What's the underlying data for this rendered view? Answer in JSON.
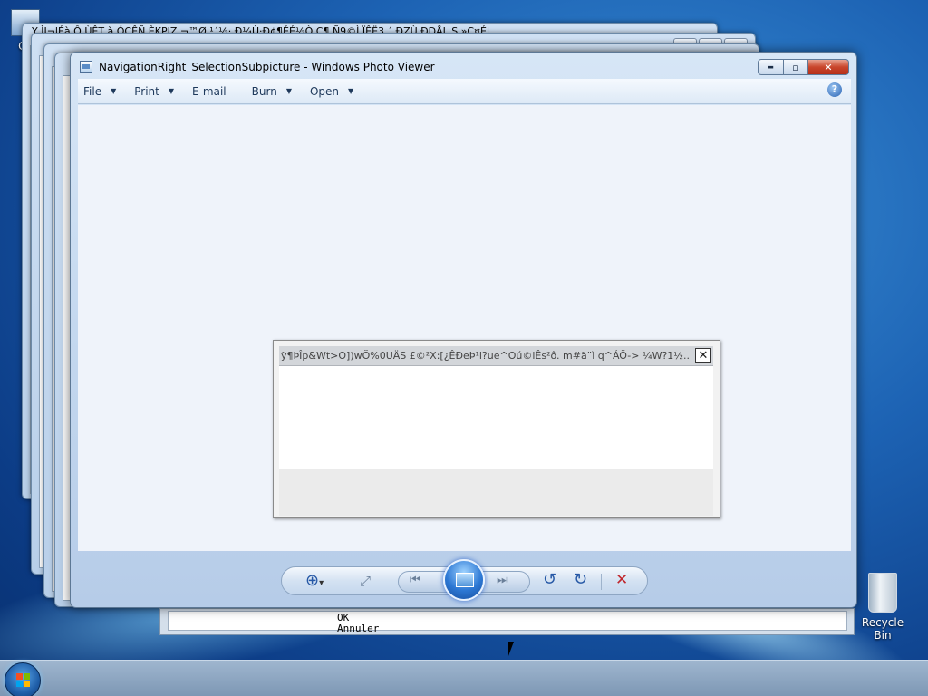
{
  "desktop": {
    "computer_label": "Co",
    "recycle_bin_label": "Recycle Bin"
  },
  "background_window": {
    "title_garbled": "Y  ÌI¬lÉà  Ô  ÙÊT   à  ÓÇÊÑ         ÈKPIZ  ¬™Ø  ¹´½·  Ð¼Ù·Ð¢¶ÉÉ½Ò  Ç¶ Ñ9©Ì    ÏÊË3  ´ ÐZÙ    ÐDÅL S    »Ç¤Él",
    "ok_label": "OK",
    "cancel_label": "Annuler"
  },
  "window": {
    "title": "NavigationRight_SelectionSubpicture - Windows Photo Viewer",
    "close_glyph": "✕",
    "max_glyph": "▫",
    "min_glyph": "▬"
  },
  "menu": {
    "items": [
      {
        "label": "File",
        "has_arrow": true
      },
      {
        "label": "Print",
        "has_arrow": true
      },
      {
        "label": "E-mail",
        "has_arrow": false
      },
      {
        "label": "Burn",
        "has_arrow": true
      },
      {
        "label": "Open",
        "has_arrow": true
      }
    ],
    "arrow_glyph": "▼",
    "help_glyph": "?"
  },
  "dialog": {
    "title_garbled": "ÿ¶ÞÎp&Wt>O])wÖ%0UÄS £©²X:[¿ÊÐeÞ¹l?ue^Oú©iÊs²ô.    m#ä¨ì q^ÁÕ->     ¼W?1½...",
    "close_glyph": "✕"
  },
  "toolbar": {
    "zoom_glyph": "⊕",
    "zoom_arrow": "▾",
    "fit_glyph": "⤢",
    "prev_glyph": "⏮",
    "next_glyph": "⏭",
    "rotate_ccw_glyph": "↺",
    "rotate_cw_glyph": "↻",
    "delete_glyph": "✕"
  },
  "colors": {
    "accent": "#2658a6",
    "delete_red": "#c0272d",
    "close_button_red": "#c9462c"
  }
}
